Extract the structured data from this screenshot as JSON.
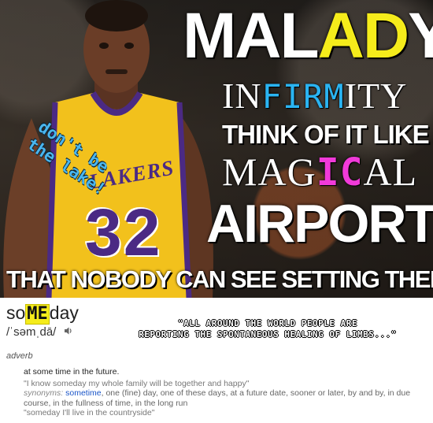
{
  "meme": {
    "title": {
      "part1": "MAL",
      "highlight": "AD",
      "part2": "Y"
    },
    "line2": {
      "part1": "IN",
      "highlight": "FIRM",
      "part2": "ITY"
    },
    "line3": "THINK OF IT LIKE A",
    "line4": {
      "part1": "MAG",
      "highlight": "IC",
      "part2": "AL"
    },
    "line5": "AIRPORT",
    "line6": "THAT NOBODY CAN SEE SETTING THEM FREE",
    "lake_note": {
      "line1": "don't be",
      "line2": "the lake!"
    },
    "jersey": {
      "team": "LAKERS",
      "number": "32"
    },
    "colors": {
      "highlight_yellow": "#f5ec1b",
      "highlight_blue": "#2ab4f2",
      "highlight_pink": "#f13ad9",
      "jersey_gold": "#f2c11c",
      "jersey_purple": "#4b2a84"
    }
  },
  "dictionary": {
    "word": {
      "part1": "so",
      "highlight": "ME",
      "part2": "day"
    },
    "pronunciation": "/ˈsəmˌdā/",
    "speaker_icon": "speaker-icon",
    "quote": {
      "line1": "\"ALL AROUND THE WORLD PEOPLE ARE",
      "line2": "REPORTING THE SPONTANEOUS HEALING OF LIMBS...\""
    },
    "part_of_speech": "adverb",
    "definition": "at some time in the future.",
    "example": "\"I know someday my whole family will be together and happy\"",
    "synonyms_label": "synonyms:",
    "synonyms_link": "sometime",
    "synonyms_rest": ", one (fine) day, one of these days, at a future date, sooner or later, by and by, in due course, in the fullness of time, in the long run",
    "example2": "\"someday I'll live in the countryside\""
  }
}
